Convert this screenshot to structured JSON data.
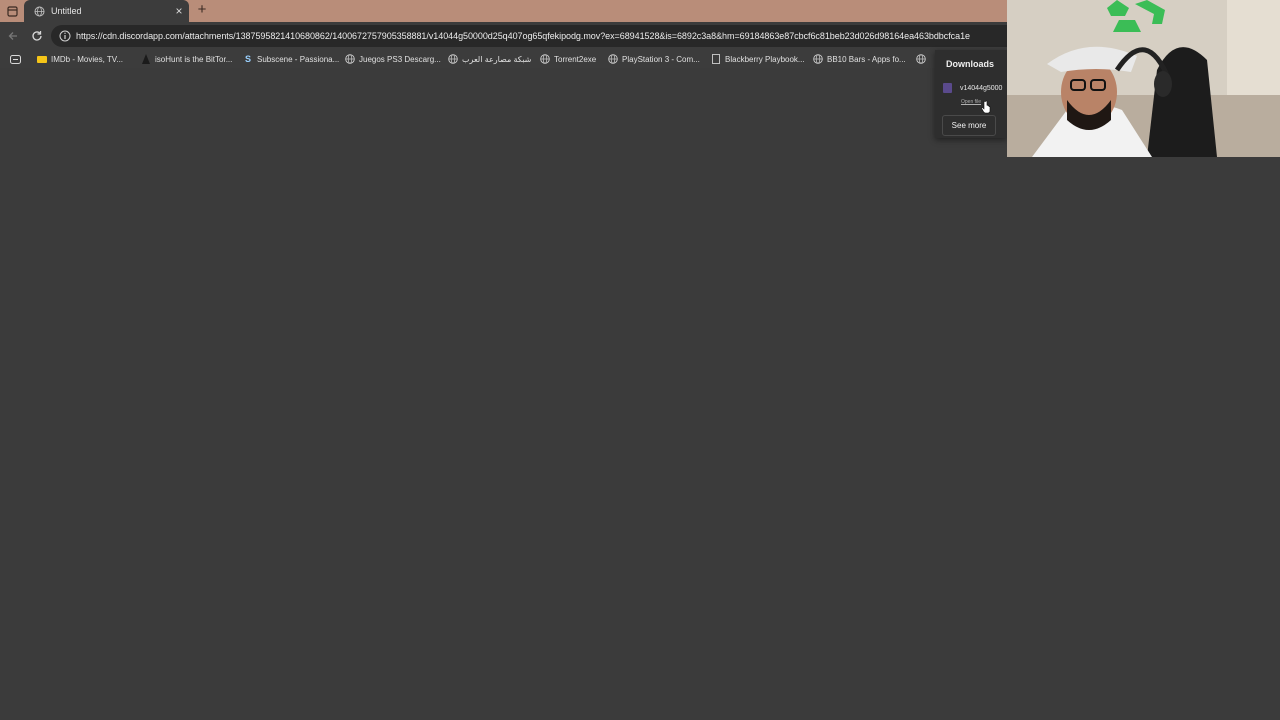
{
  "tab": {
    "title": "Untitled"
  },
  "omnibox": {
    "url": "https://cdn.discordapp.com/attachments/1387595821410680862/1400672757905358881/v14044g50000d25q407og65qfekipodg.mov?ex=68941528&is=6892c3a8&hm=69184863e87cbcf6c81beb23d026d98164ea463bdbcfca1e"
  },
  "bookmarks": [
    {
      "label": "IMDb - Movies, TV...",
      "icon": "imdb-icon"
    },
    {
      "label": "isoHunt is the BitTor...",
      "icon": "isohunt-icon"
    },
    {
      "label": "Subscene - Passiona...",
      "icon": "subscene-icon"
    },
    {
      "label": "Juegos PS3 Descarg...",
      "icon": "globe-icon"
    },
    {
      "label": "شبكة مصارعة العرب",
      "icon": "globe-icon"
    },
    {
      "label": "Torrent2exe",
      "icon": "globe-icon"
    },
    {
      "label": "PlayStation 3 - Com...",
      "icon": "globe-icon"
    },
    {
      "label": "Blackberry Playbook...",
      "icon": "page-icon"
    },
    {
      "label": "BB10 Bars - Apps fo...",
      "icon": "globe-icon"
    }
  ],
  "downloads": {
    "title": "Downloads",
    "item_name": "v14044g5000",
    "open_file": "Open file",
    "see_more": "See more"
  },
  "colors": {
    "tabstrip": "#b98d79",
    "toolbar": "#3c3c3c",
    "page": "#3b3b3b",
    "popup": "#2e2e2e"
  }
}
